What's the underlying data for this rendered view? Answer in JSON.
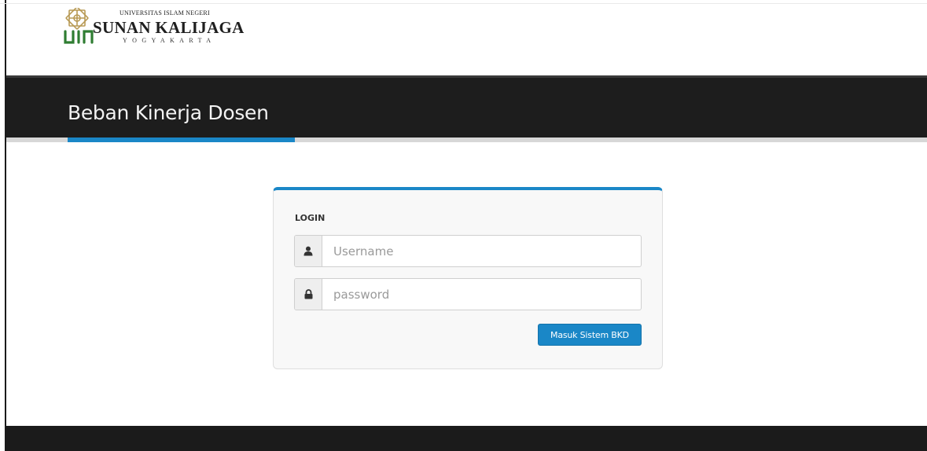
{
  "logo": {
    "line1": "UNIVERSITAS ISLAM NEGERI",
    "line2": "SUNAN KALIJAGA",
    "line3": "YOGYAKARTA"
  },
  "header": {
    "title": "Beban Kinerja Dosen"
  },
  "login": {
    "heading": "LOGIN",
    "username_placeholder": "Username",
    "username_value": "",
    "password_placeholder": "password",
    "password_value": "",
    "submit_label": "Masuk Sistem BKD"
  },
  "icons": {
    "user": "user-icon",
    "password": "lock-icon",
    "logo": "uin-logo-icon"
  },
  "colors": {
    "accent": "#1a87c7",
    "header_bg": "#1d1d1d",
    "logo_green": "#2f7d32",
    "logo_gold": "#b89a55"
  }
}
